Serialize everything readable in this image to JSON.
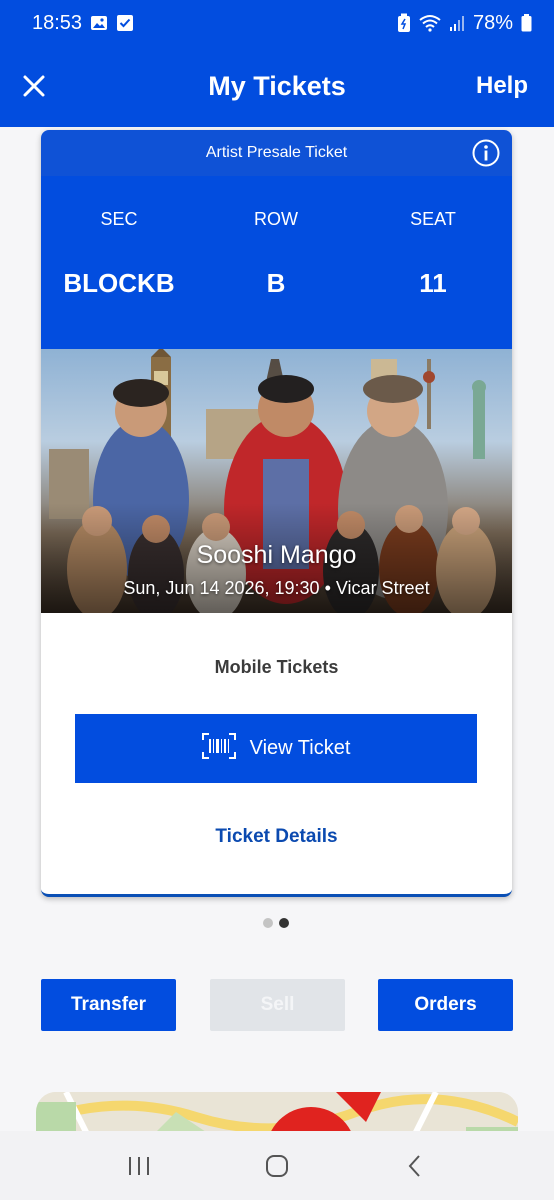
{
  "status_bar": {
    "time": "18:53",
    "battery": "78%",
    "icons_left": [
      "gallery-icon",
      "checkbox-icon"
    ],
    "icons_right": [
      "battery-saver-icon",
      "wifi-icon",
      "signal-icon",
      "battery-icon"
    ]
  },
  "header": {
    "title": "My Tickets",
    "help_label": "Help",
    "close_icon": "close-icon"
  },
  "ticket": {
    "type_label": "Artist Presale Ticket",
    "info_icon": "info-icon",
    "sec_label": "SEC",
    "row_label": "ROW",
    "seat_label": "SEAT",
    "sec_value": "BLOCKB",
    "row_value": "B",
    "seat_value": "11",
    "event_name": "Sooshi Mango",
    "event_info": "Sun, Jun 14 2026, 19:30 • Vicar Street",
    "mobile_label": "Mobile Tickets",
    "view_button": "View Ticket",
    "view_icon": "barcode-icon",
    "details_link": "Ticket Details"
  },
  "pagination": {
    "total": 2,
    "active": 2
  },
  "actions": {
    "transfer": "Transfer",
    "sell": "Sell",
    "orders": "Orders"
  },
  "nav": [
    "recent-apps-icon",
    "home-icon",
    "back-icon"
  ],
  "colors": {
    "brand_blue": "#024ddf",
    "card_header_blue": "#0f52d6",
    "link_blue": "#0b4ab0",
    "disabled_gray": "#e1e4e8"
  }
}
